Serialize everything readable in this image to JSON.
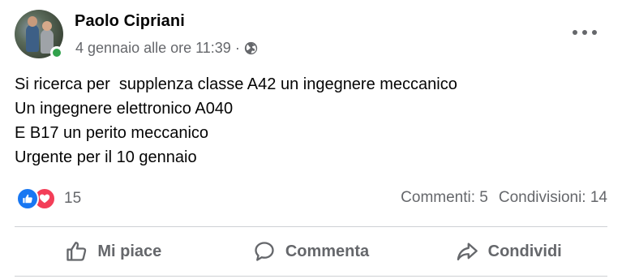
{
  "post": {
    "author": "Paolo Cipriani",
    "timestamp": "4 gennaio alle ore 11:39",
    "separator": "·",
    "audience_icon": "globe-icon",
    "options_icon": "more-options-icon",
    "online": true,
    "text": "Si ricerca per  supplenza classe A42 un ingegnere meccanico\nUn ingegnere elettronico A040\nE B17 un perito meccanico\nUrgente per il 10 gennaio"
  },
  "reactions": {
    "types": [
      "like-icon",
      "love-icon"
    ],
    "count": "15"
  },
  "stats": {
    "comments": "Commenti: 5",
    "shares": "Condivisioni: 14"
  },
  "actions": {
    "like": "Mi piace",
    "comment": "Commenta",
    "share": "Condividi"
  },
  "colors": {
    "like_blue": "#1877f2",
    "love_red": "#f33e58",
    "online_green": "#31a24c",
    "secondary_text": "#65676b"
  }
}
